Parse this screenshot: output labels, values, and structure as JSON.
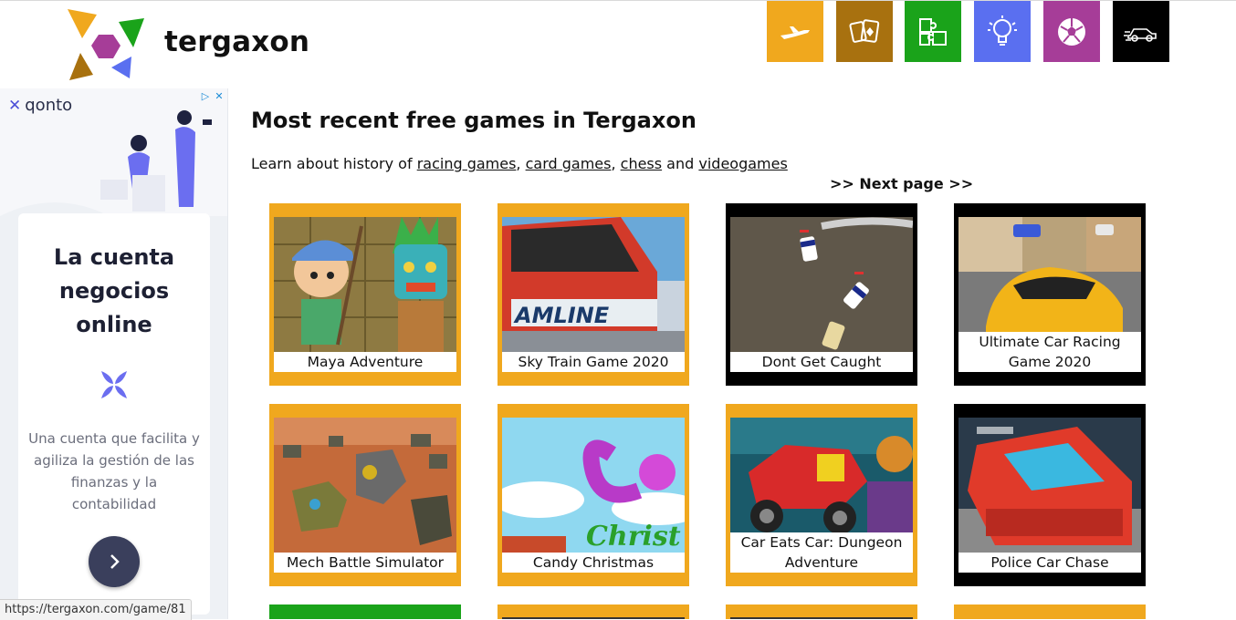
{
  "header": {
    "brand": "tergaxon",
    "categories": [
      {
        "name": "aircraft",
        "color": "#f0a81e"
      },
      {
        "name": "cards",
        "color": "#a8710f"
      },
      {
        "name": "puzzle",
        "color": "#1aa31a"
      },
      {
        "name": "ideas",
        "color": "#5a6ff0"
      },
      {
        "name": "sports",
        "color": "#a63d98"
      },
      {
        "name": "cars",
        "color": "#000000"
      }
    ]
  },
  "ad": {
    "brand": "qonto",
    "title": "La cuenta negocios online",
    "body": "Una cuenta que facilita y agiliza la gestión de las finanzas y la contabilidad"
  },
  "main": {
    "heading": "Most recent free games in Tergaxon",
    "history_prefix": "Learn about history of ",
    "links": [
      "racing games",
      "card games",
      "chess",
      "videogames"
    ],
    "sep1": ", ",
    "sep2": ", ",
    "sep3": " and ",
    "next_page": ">> Next page >>"
  },
  "games": [
    {
      "title": "Maya Adventure",
      "frame": "#f0a81e"
    },
    {
      "title": "Sky Train Game 2020",
      "frame": "#f0a81e"
    },
    {
      "title": "Dont Get Caught",
      "frame": "#000000"
    },
    {
      "title": "Ultimate Car Racing Game 2020",
      "frame": "#000000"
    },
    {
      "title": "Mech Battle Simulator",
      "frame": "#f0a81e"
    },
    {
      "title": "Candy Christmas",
      "frame": "#f0a81e"
    },
    {
      "title": "Car Eats Car: Dungeon Adventure",
      "frame": "#f0a81e"
    },
    {
      "title": "Police Car Chase",
      "frame": "#000000"
    }
  ],
  "thumb_text": {
    "train_text": "AMLINE",
    "candy_text": "Christ"
  },
  "status_bar": "https://tergaxon.com/game/81"
}
